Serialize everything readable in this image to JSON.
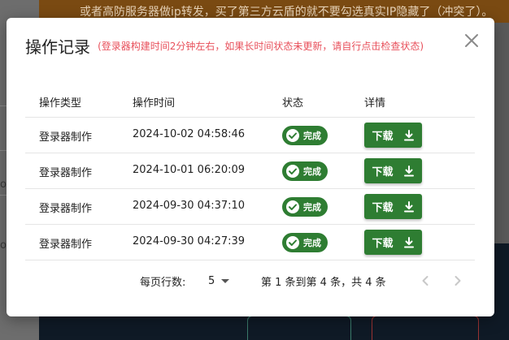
{
  "background": {
    "banner_text": "或者高防服务器做ip转发，买了第三方云盾的就不要勾选真实IP隐藏了（冲突了）。",
    "left_chars": [
      "o",
      "o"
    ]
  },
  "dialog": {
    "title": "操作记录",
    "subtitle": "(登录器构建时间2分钟左右，如果长时间状态未更新，请自行点击检查状态)",
    "close_icon": "close-icon"
  },
  "table": {
    "headers": {
      "type": "操作类型",
      "time": "操作时间",
      "status": "状态",
      "detail": "详情"
    },
    "rows": [
      {
        "type": "登录器制作",
        "time": "2024-10-02 04:58:46",
        "status": "完成",
        "action": "下载"
      },
      {
        "type": "登录器制作",
        "time": "2024-10-01 06:20:09",
        "status": "完成",
        "action": "下载"
      },
      {
        "type": "登录器制作",
        "time": "2024-09-30 04:37:10",
        "status": "完成",
        "action": "下载"
      },
      {
        "type": "登录器制作",
        "time": "2024-09-30 04:27:39",
        "status": "完成",
        "action": "下载"
      }
    ]
  },
  "pagination": {
    "rows_per_page_label": "每页行数:",
    "rows_per_page_value": "5",
    "range_text": "第 1 条到第 4 条，共 4 条"
  },
  "colors": {
    "accent_green": "#2e7d32",
    "subtitle_red": "#e8505b"
  }
}
